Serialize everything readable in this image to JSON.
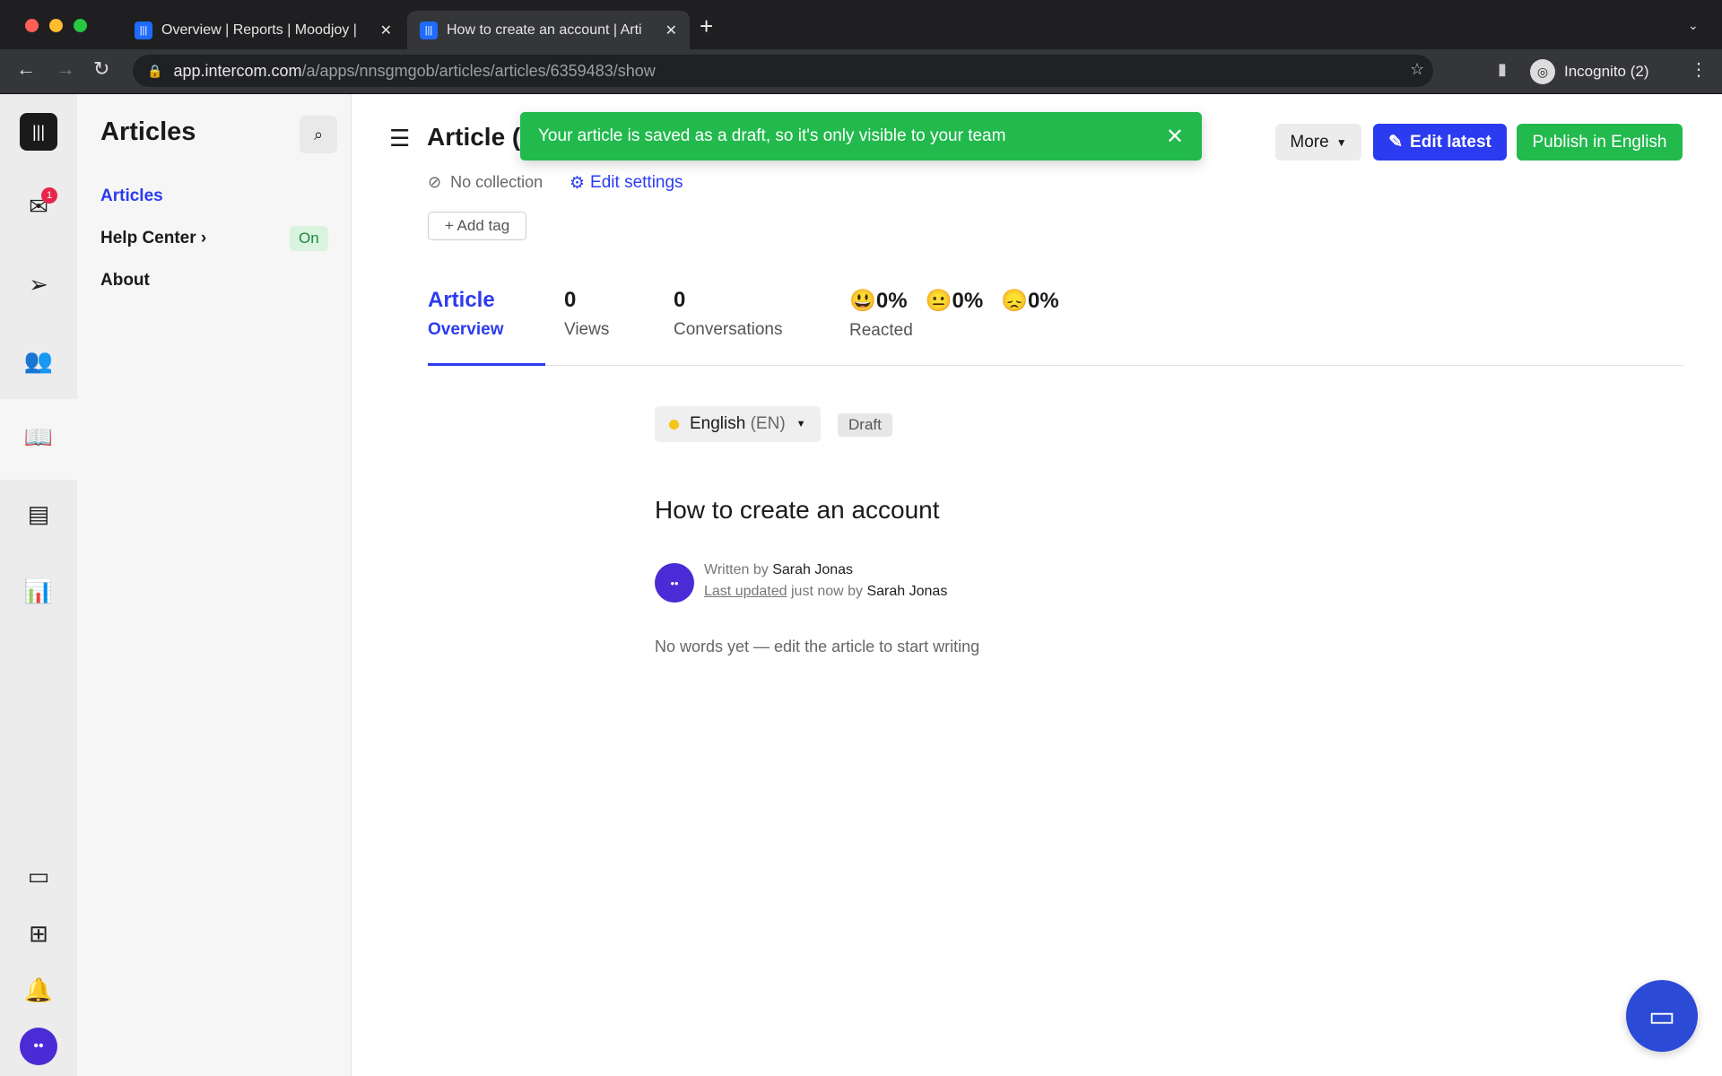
{
  "browser": {
    "tabs": [
      {
        "title": "Overview | Reports | Moodjoy |"
      },
      {
        "title": "How to create an account | Arti"
      }
    ],
    "url_host": "app.intercom.com",
    "url_path": "/a/apps/nnsgmgob/articles/articles/6359483/show",
    "profile": "Incognito (2)"
  },
  "rail": {
    "inbox_badge": "1"
  },
  "sidebar": {
    "title": "Articles",
    "items": [
      {
        "label": "Articles"
      },
      {
        "label": "Help Center",
        "badge": "On"
      },
      {
        "label": "About"
      }
    ]
  },
  "header": {
    "title": "Article (",
    "more": "More",
    "edit_latest": "Edit latest",
    "publish": "Publish in English",
    "collection": "No collection",
    "edit_settings": "Edit settings",
    "add_tag": "+ Add tag"
  },
  "toast": {
    "message": "Your article is saved as a draft, so it's only visible to your team"
  },
  "stats": {
    "tab_top": "Article",
    "tab_bottom": "Overview",
    "views": "0",
    "views_label": "Views",
    "conversations": "0",
    "conversations_label": "Conversations",
    "reactions": [
      {
        "emoji": "😃",
        "value": "0%"
      },
      {
        "emoji": "😐",
        "value": "0%"
      },
      {
        "emoji": "😞",
        "value": "0%"
      }
    ],
    "reacted_label": "Reacted"
  },
  "article": {
    "language": "English",
    "language_code": "(EN)",
    "status": "Draft",
    "title": "How to create an account",
    "written_by": "Written by",
    "author": "Sarah Jonas",
    "last_updated": "Last updated",
    "updated_when": "just now by",
    "updater": "Sarah Jonas",
    "empty": "No words yet — edit the article to start writing"
  },
  "colors": {
    "accent": "#2b3bf0",
    "green": "#22b94d",
    "lang_dot": "#f5c518"
  }
}
